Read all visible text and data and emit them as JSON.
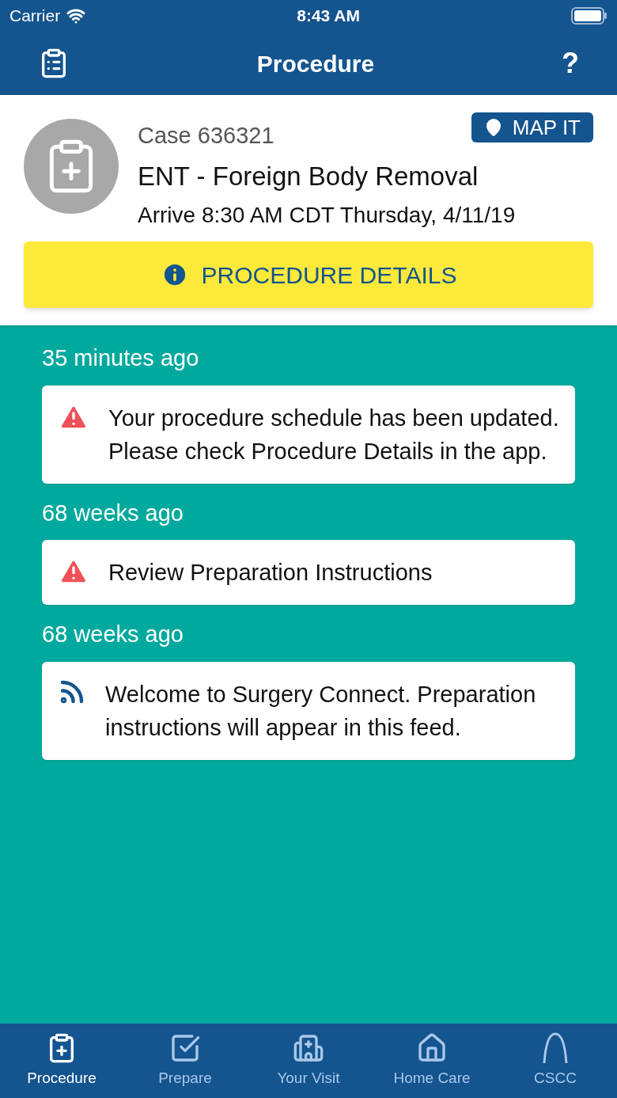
{
  "status_bar": {
    "carrier": "Carrier",
    "time": "8:43 AM"
  },
  "nav": {
    "title": "Procedure",
    "help": "?"
  },
  "case": {
    "number": "Case 636321",
    "name": "ENT - Foreign Body Removal",
    "arrival": "Arrive 8:30 AM CDT Thursday, 4/11/19",
    "map_button": "MAP IT",
    "details_button": "PROCEDURE DETAILS"
  },
  "feed": [
    {
      "time": "35 minutes ago",
      "kind": "alert",
      "message": "Your procedure schedule has been updated. Please check Procedure Details in the app."
    },
    {
      "time": "68 weeks ago",
      "kind": "alert",
      "message": "Review Preparation Instructions"
    },
    {
      "time": "68 weeks ago",
      "kind": "feed",
      "message": "Welcome to Surgery Connect. Preparation instructions will appear in this feed."
    }
  ],
  "tabs": [
    {
      "label": "Procedure",
      "kind": "clipboard",
      "selected": true
    },
    {
      "label": "Prepare",
      "kind": "check",
      "selected": false
    },
    {
      "label": "Your Visit",
      "kind": "hospital",
      "selected": false
    },
    {
      "label": "Home Care",
      "kind": "home",
      "selected": false
    },
    {
      "label": "CSCC",
      "kind": "arch",
      "selected": false
    }
  ]
}
